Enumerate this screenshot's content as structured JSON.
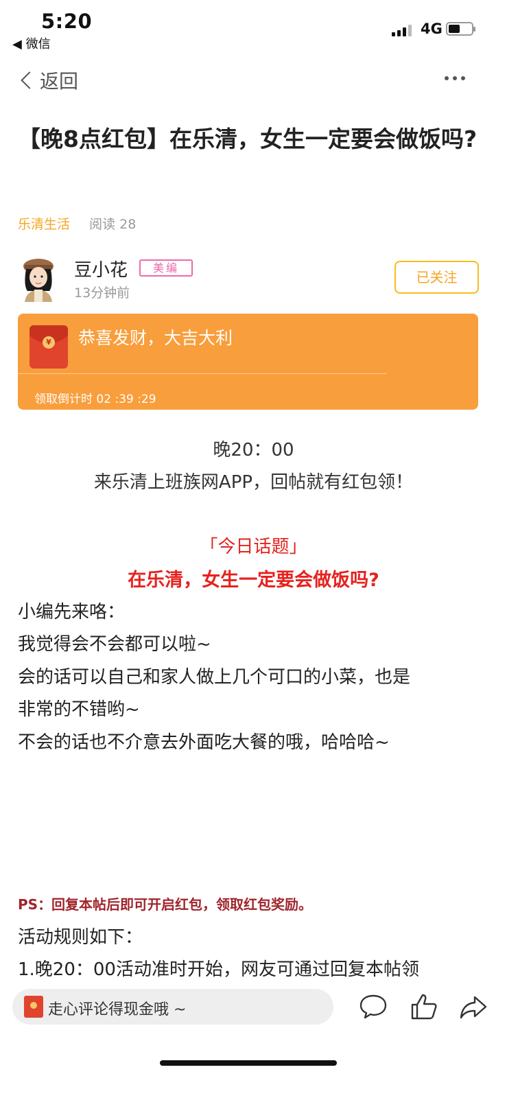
{
  "status_bar": {
    "time": "5:20",
    "back_app": "◀ 微信",
    "network": "4G",
    "battery_level": 0.5
  },
  "nav": {
    "back_label": "返回"
  },
  "article": {
    "title": "【晚8点红包】在乐清，女生一定要会做饭吗?",
    "channel": "乐清生活",
    "reads": "阅读 28"
  },
  "author": {
    "name": "豆小花",
    "badge": "美编",
    "time": "13分钟前",
    "follow_label": "已关注"
  },
  "red_packet": {
    "greeting": "恭喜发财，大吉大利",
    "countdown": "领取倒计时 02 :39 :29"
  },
  "body": {
    "time_line": "晚20：00",
    "promo_line": "来乐清上班族网APP，回帖就有红包领！",
    "topic_label": "「今日话题」",
    "topic_question": "在乐清，女生一定要会做饭吗?",
    "lines": [
      "小编先来咯：",
      "我觉得会不会都可以啦~",
      "会的话可以自己和家人做上几个可口的小菜，也是",
      "非常的不错哟~",
      "不会的话也不介意去外面吃大餐的哦，哈哈哈~"
    ],
    "ps": "PS：回复本帖后即可开启红包，领取红包奖励。",
    "rules_title": "活动规则如下：",
    "rule_1": "1.晚20：00活动准时开始，网友可通过回复本帖领"
  },
  "bottom_bar": {
    "comment_placeholder": "走心评论得现金哦 ~"
  },
  "colors": {
    "accent_orange": "#f99e3c",
    "channel_yellow": "#f5a623",
    "topic_red": "#e6221e",
    "badge_pink": "#ec6aa8"
  }
}
